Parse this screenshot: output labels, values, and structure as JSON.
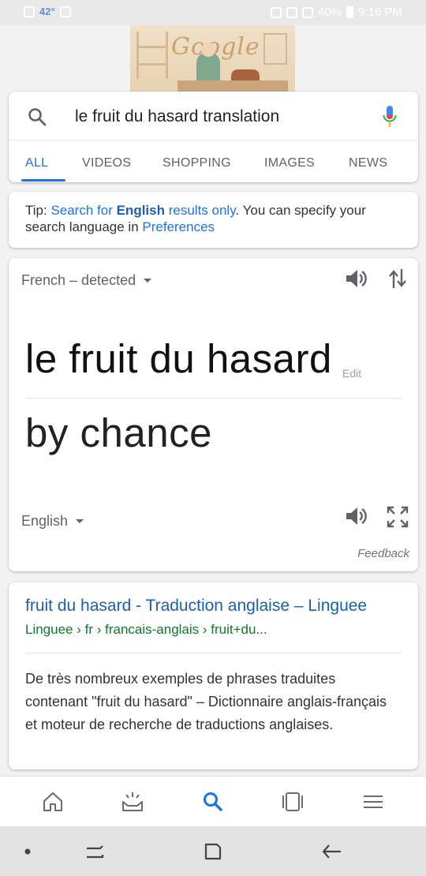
{
  "status_bar": {
    "temperature": "42°",
    "battery": "40%",
    "time": "9:16 PM"
  },
  "doodle": {
    "logo_word": "Google"
  },
  "search": {
    "query": "le fruit du hasard translation",
    "tabs": [
      {
        "label": "ALL",
        "active": true
      },
      {
        "label": "VIDEOS",
        "active": false
      },
      {
        "label": "SHOPPING",
        "active": false
      },
      {
        "label": "IMAGES",
        "active": false
      },
      {
        "label": "NEWS",
        "active": false
      }
    ]
  },
  "tip": {
    "prefix": "Tip: ",
    "link1_a": "Search for ",
    "link1_bold": "English",
    "link1_b": " results only",
    "middle": ". You can specify your search language in ",
    "link2": "Preferences"
  },
  "translate": {
    "source_lang": "French – detected",
    "source_text": "le fruit du hasard",
    "edit_label": "Edit",
    "target_text": "by chance",
    "target_lang": "English",
    "feedback_label": "Feedback"
  },
  "result": {
    "title": "fruit du hasard - Traduction anglaise – Linguee",
    "url": "Linguee › fr › francais-anglais › fruit+du...",
    "snippet": "De très nombreux exemples de phrases traduites contenant \"fruit du hasard\" – Dictionnaire anglais-français et moteur de recherche de traductions anglaises."
  },
  "colors": {
    "accent": "#1a73e8",
    "link": "#1a5fb4",
    "url_green": "#0b7a2a"
  },
  "icons": {
    "app_bar": [
      "home-icon",
      "updates-icon",
      "search-icon",
      "recents-icon",
      "menu-icon"
    ],
    "nav_bar": [
      "dot-icon",
      "recent-apps-icon",
      "home-square-icon",
      "back-icon"
    ]
  }
}
